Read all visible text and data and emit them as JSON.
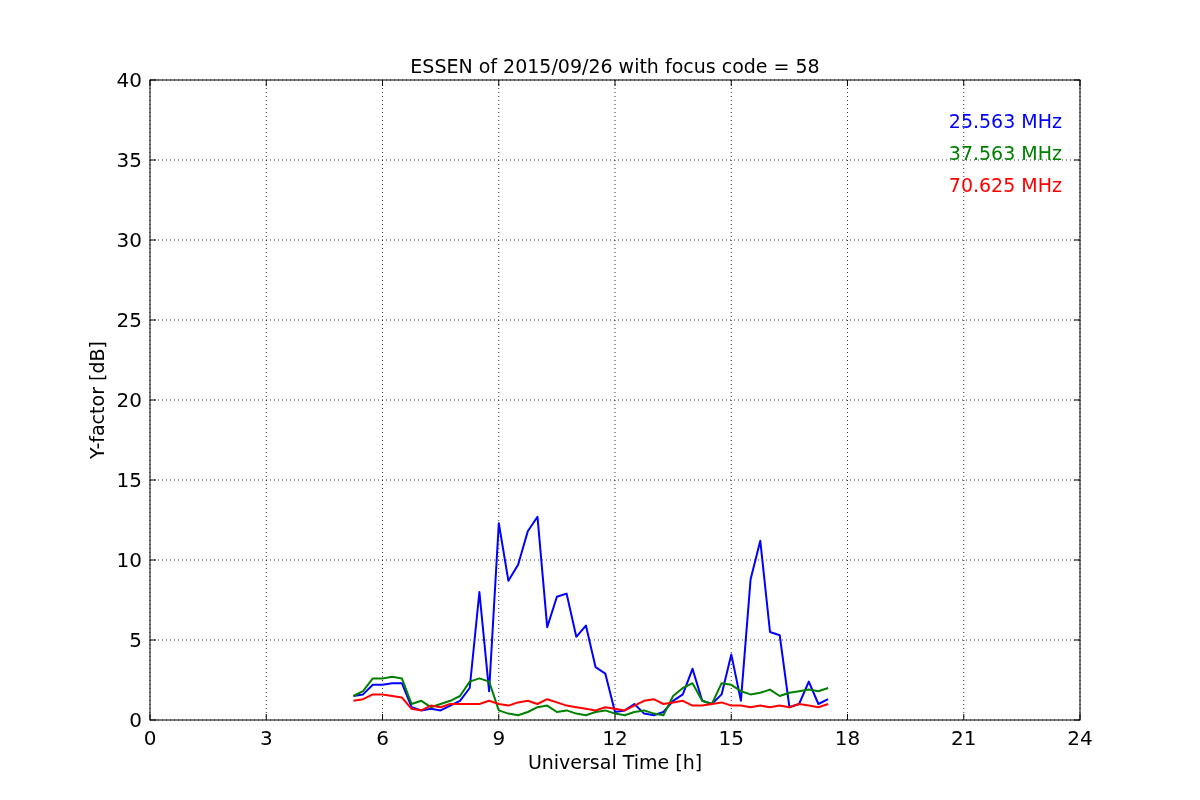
{
  "chart_data": {
    "type": "line",
    "title": "ESSEN of 2015/09/26 with focus code = 58",
    "xlabel": "Universal Time [h]",
    "ylabel": "Y-factor [dB]",
    "x": [
      5.25,
      5.5,
      5.75,
      6,
      6.25,
      6.5,
      6.75,
      7,
      7.25,
      7.5,
      7.75,
      8,
      8.25,
      8.5,
      8.75,
      9,
      9.25,
      9.5,
      9.75,
      10,
      10.25,
      10.5,
      10.75,
      11,
      11.25,
      11.5,
      11.75,
      12,
      12.25,
      12.5,
      12.75,
      13,
      13.25,
      13.5,
      13.75,
      14,
      14.25,
      14.5,
      14.75,
      15,
      15.25,
      15.5,
      15.75,
      16,
      16.25,
      16.5,
      16.75,
      17,
      17.25,
      17.5
    ],
    "series": [
      {
        "name": "25.563 MHz",
        "color": "#0000ff",
        "values": [
          1.5,
          1.6,
          2.2,
          2.2,
          2.3,
          2.3,
          0.8,
          0.6,
          0.7,
          0.6,
          0.9,
          1.2,
          2.0,
          8.0,
          1.8,
          12.3,
          8.7,
          9.7,
          11.8,
          12.7,
          5.8,
          7.7,
          7.9,
          5.2,
          5.9,
          3.3,
          2.9,
          0.5,
          0.6,
          1.0,
          0.4,
          0.3,
          0.5,
          1.2,
          1.6,
          3.2,
          1.2,
          1.0,
          1.6,
          4.1,
          1.2,
          8.8,
          11.2,
          5.5,
          5.3,
          0.8,
          1.0,
          2.4,
          1.0,
          1.3
        ]
      },
      {
        "name": "37.563 MHz",
        "color": "#008000",
        "values": [
          1.5,
          1.8,
          2.6,
          2.6,
          2.7,
          2.6,
          1.0,
          1.2,
          0.8,
          1.0,
          1.2,
          1.5,
          2.4,
          2.6,
          2.4,
          0.6,
          0.4,
          0.3,
          0.5,
          0.8,
          0.9,
          0.5,
          0.6,
          0.4,
          0.3,
          0.5,
          0.6,
          0.4,
          0.3,
          0.5,
          0.6,
          0.4,
          0.3,
          1.5,
          2.0,
          2.3,
          1.2,
          1.0,
          2.3,
          2.2,
          1.8,
          1.6,
          1.7,
          1.9,
          1.5,
          1.7,
          1.8,
          1.9,
          1.8,
          2.0
        ]
      },
      {
        "name": "70.625 MHz",
        "color": "#ff0000",
        "values": [
          1.2,
          1.3,
          1.6,
          1.6,
          1.5,
          1.4,
          0.7,
          0.6,
          0.9,
          0.8,
          1.0,
          1.0,
          1.0,
          1.0,
          1.2,
          1.0,
          0.9,
          1.1,
          1.2,
          1.0,
          1.3,
          1.1,
          0.9,
          0.8,
          0.7,
          0.6,
          0.8,
          0.7,
          0.6,
          0.9,
          1.2,
          1.3,
          1.0,
          1.1,
          1.2,
          0.9,
          0.9,
          1.0,
          1.1,
          0.9,
          0.9,
          0.8,
          0.9,
          0.8,
          0.9,
          0.8,
          1.0,
          0.9,
          0.8,
          1.0
        ]
      }
    ],
    "grid": true,
    "xlim": [
      0,
      24
    ],
    "ylim": [
      0,
      40
    ],
    "xticks": [
      0,
      3,
      6,
      9,
      12,
      15,
      18,
      21,
      24
    ],
    "yticks": [
      0,
      5,
      10,
      15,
      20,
      25,
      30,
      35,
      40
    ]
  }
}
